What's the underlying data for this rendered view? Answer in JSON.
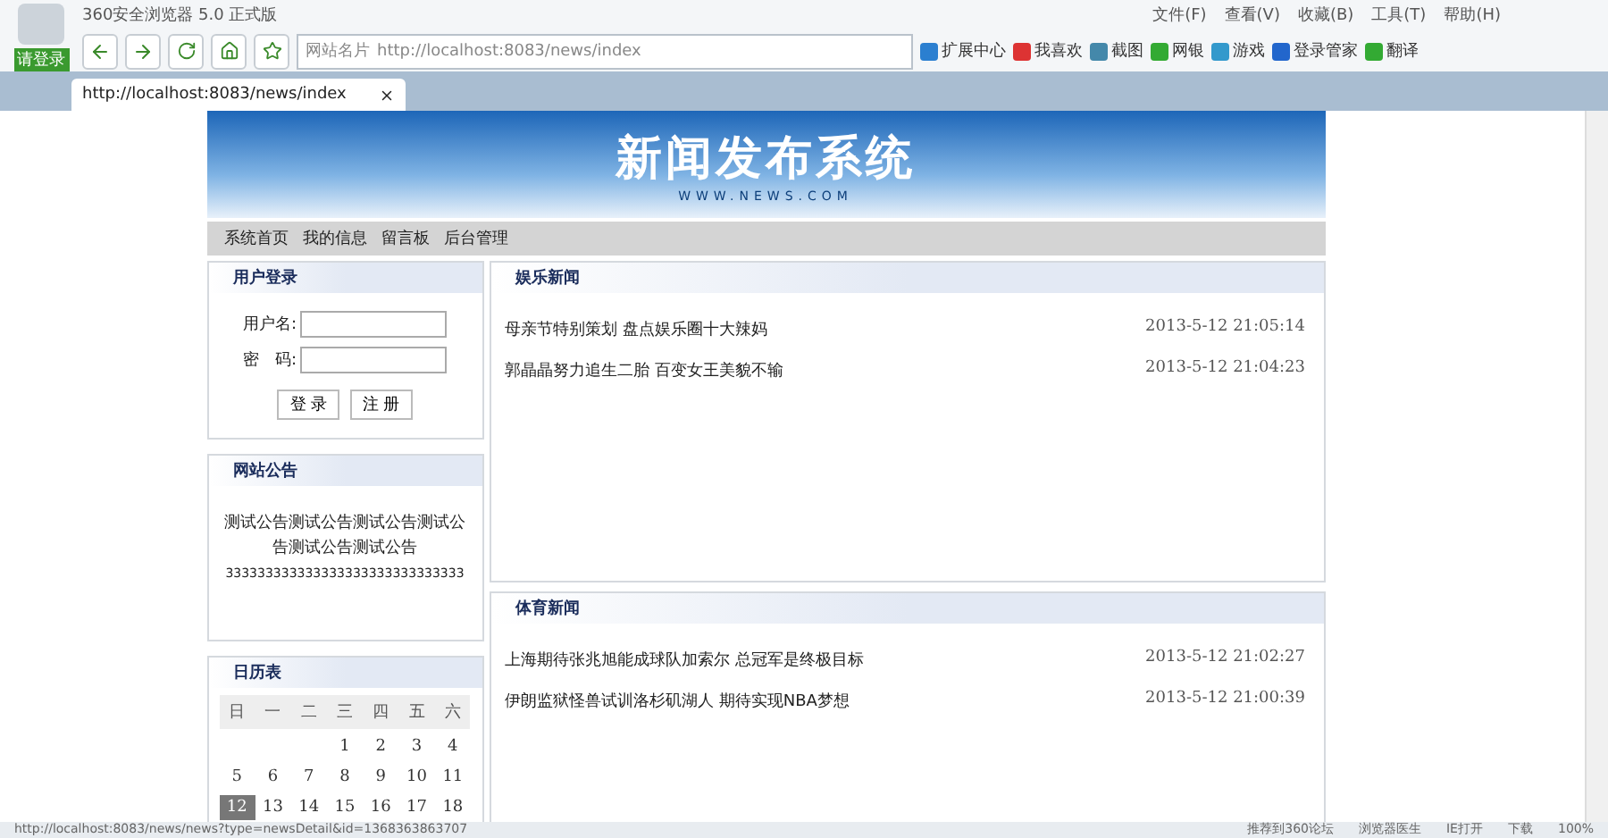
{
  "browser": {
    "title": "360安全浏览器 5.0 正式版",
    "login_label": "请登录",
    "menu": [
      "文件(F)",
      "查看(V)",
      "收藏(B)",
      "工具(T)",
      "帮助(H)"
    ],
    "site_card": "网站名片",
    "address": "http://localhost:8083/news/index",
    "tools": [
      "扩展中心",
      "我喜欢",
      "截图",
      "网银",
      "游戏",
      "登录管家",
      "翻译"
    ],
    "tabs": [
      {
        "label": "http://localhost:8083/news/index",
        "selected": true
      }
    ]
  },
  "site": {
    "banner_title": "新闻发布系统",
    "banner_sub": "WWW.NEWS.COM",
    "nav": [
      "系统首页",
      "我的信息",
      "留言板",
      "后台管理"
    ]
  },
  "login": {
    "title": "用户登录",
    "fields": [
      {
        "label": "用户名:"
      },
      {
        "label": "密　码:"
      }
    ],
    "buttons": [
      "登 录",
      "注 册"
    ]
  },
  "notice": {
    "title": "网站公告",
    "text": "测试公告测试公告测试公告测试公告测试公告测试公告",
    "extra": "333333333333333333333333333333"
  },
  "calendar": {
    "title": "日历表",
    "weekdays": [
      "日",
      "一",
      "二",
      "三",
      "四",
      "五",
      "六"
    ],
    "weeks": [
      [
        {
          "day": "1",
          "selected": false
        },
        {
          "day": "2",
          "selected": false
        },
        {
          "day": "3",
          "selected": false
        },
        {
          "day": "4",
          "selected": false
        }
      ],
      [
        {
          "day": "5",
          "selected": false
        },
        {
          "day": "6",
          "selected": false
        },
        {
          "day": "7",
          "selected": false
        },
        {
          "day": "8",
          "selected": false
        },
        {
          "day": "9",
          "selected": false
        },
        {
          "day": "10",
          "selected": false
        },
        {
          "day": "11",
          "selected": false
        }
      ],
      [
        {
          "day": "12",
          "selected": true
        },
        {
          "day": "13",
          "selected": false
        },
        {
          "day": "14",
          "selected": false
        },
        {
          "day": "15",
          "selected": false
        },
        {
          "day": "16",
          "selected": false
        },
        {
          "day": "17",
          "selected": false
        },
        {
          "day": "18",
          "selected": false
        }
      ]
    ]
  },
  "sections": [
    {
      "title": "娱乐新闻",
      "items": [
        {
          "headline": "母亲节特别策划 盘点娱乐圈十大辣妈",
          "time": "2013-5-12 21:05:14"
        },
        {
          "headline": "郭晶晶努力追生二胎 百变女王美貌不输",
          "time": "2013-5-12 21:04:23"
        }
      ]
    },
    {
      "title": "体育新闻",
      "items": [
        {
          "headline": "上海期待张兆旭能成球队加索尔 总冠军是终极目标",
          "time": "2013-5-12 21:02:27"
        },
        {
          "headline": "伊朗监狱怪兽试训洛杉矶湖人 期待实现NBA梦想",
          "time": "2013-5-12 21:00:39"
        }
      ]
    }
  ],
  "status_bar": {
    "url": "http://localhost:8083/news/news?type=newsDetail&id=1368363863707",
    "items": [
      "推荐到360论坛",
      "浏览器医生",
      "IE打开",
      "下载",
      "100%"
    ]
  }
}
